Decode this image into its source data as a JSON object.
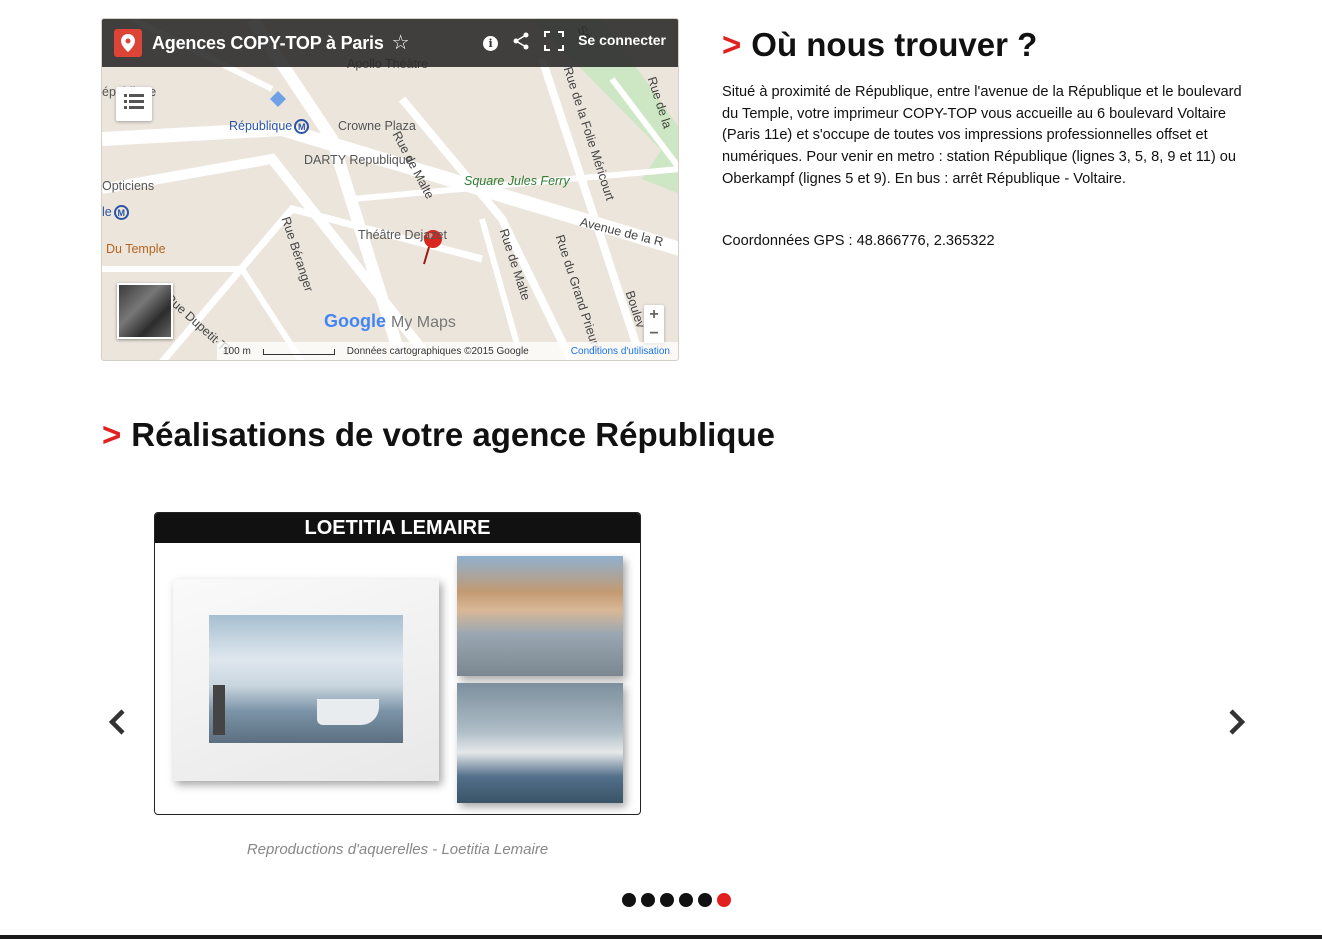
{
  "map": {
    "title": "Agences COPY-TOP à Paris",
    "signin": "Se connecter",
    "labels": {
      "apollo": "Apollo Théâtre",
      "republique_edge": "épublique",
      "republique_metro": "République",
      "crowne": "Crowne Plaza",
      "darty": "DARTY Republique",
      "rue_malte_1": "Rue de Malte",
      "square": "Square Jules Ferry",
      "opticiens": "Opticiens",
      "le_metro": "le",
      "du_temple": "Du Temple",
      "theatre": "Théâtre Dejazet",
      "rue_beranger": "Rue Béranger",
      "rue_malte_2": "Rue de Malte",
      "rue_grand": "Rue du Grand Prieuré",
      "avenue": "Avenue de la R",
      "rue_folie": "Rue de la Folie Méricourt",
      "rue_de_la": "Rue de la",
      "dupetit": "Rue Dupetit-Th",
      "boule": "Boulev",
      "se_edge": "Se"
    },
    "logo_google": "Google",
    "logo_mymaps": "My Maps",
    "scale": "100 m",
    "copyright": "Données cartographiques ©2015 Google",
    "terms": "Conditions d'utilisation",
    "zoom_in": "+",
    "zoom_out": "−",
    "metro_symbol": "M"
  },
  "where": {
    "chevron": ">",
    "title": "Où nous trouver ?",
    "description": "Situé à proximité de République, entre l'avenue de la République et le boulevard du Temple, votre imprimeur COPY-TOP vous accueille au 6 boulevard Voltaire (Paris 11e) et s'occupe de toutes vos impressions professionnelles offset et numériques. Pour venir en metro : station République (lignes 3, 5, 8, 9 et 11) ou Oberkampf (lignes 5 et 9). En bus : arrêt République - Voltaire.",
    "gps": "Coordonnées GPS : 48.866776, 2.365322"
  },
  "realisations": {
    "chevron": ">",
    "title": "Réalisations de votre agence République",
    "card_title": "LOETITIA LEMAIRE",
    "caption": "Reproductions d'aquerelles - Loetitia Lemaire",
    "slide_count": 6,
    "active_slide": 6
  },
  "colors": {
    "accent": "#e2201f",
    "map_pin": "#db4437",
    "metro": "#2d55a5"
  }
}
